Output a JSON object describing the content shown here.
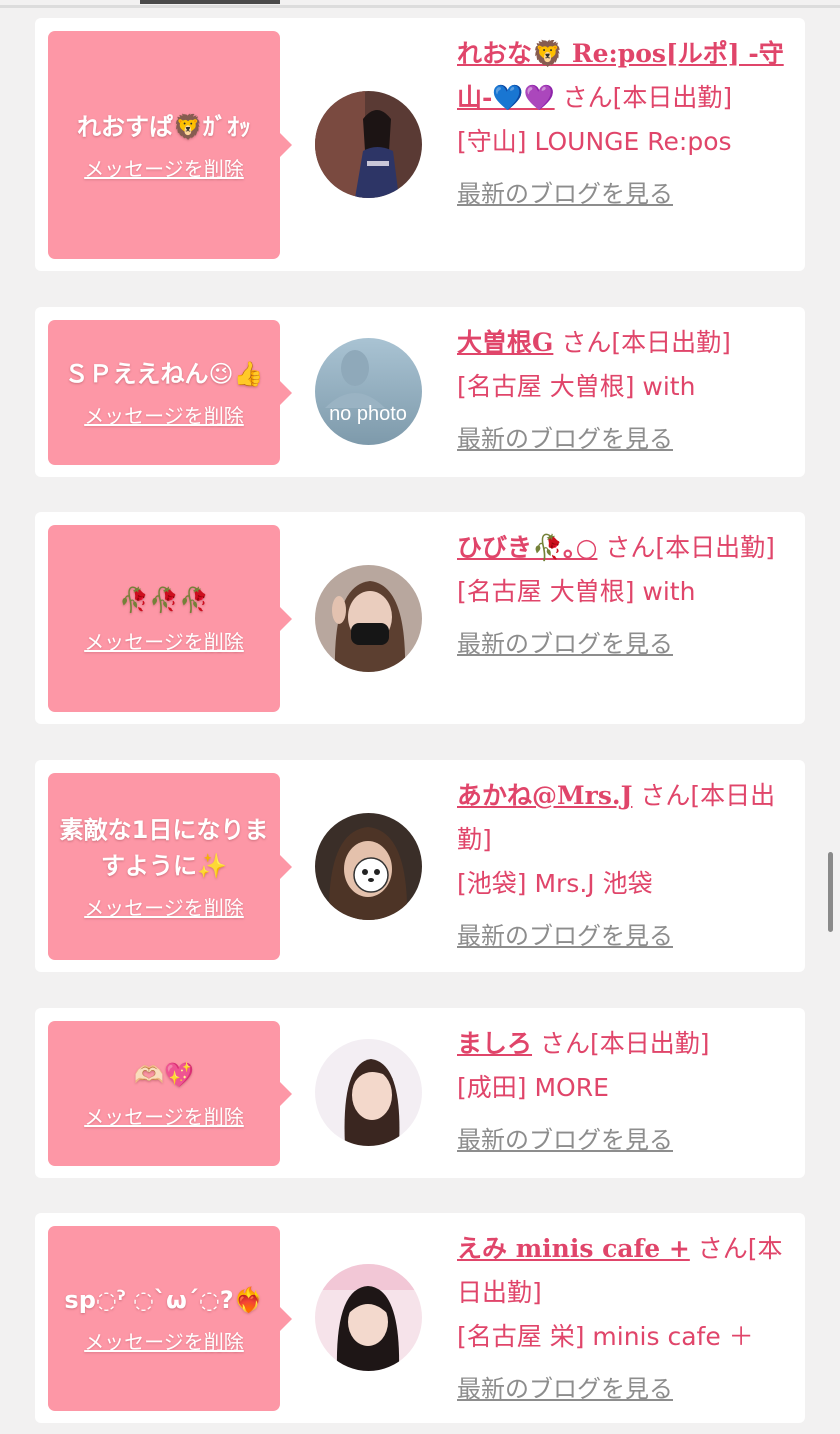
{
  "entries": [
    {
      "message": "れおすぱ🦁ｶﾞｵｯ",
      "delete_label": "メッセージを削除",
      "name": "れおな🦁 Re:pos[ルポ] -守山-💙💜",
      "san": "さん[本日出勤]",
      "shop": "[守山] LOUNGE Re:pos",
      "blog_link": "最新のブログを見る"
    },
    {
      "message": "ＳＰええねん😉👍",
      "delete_label": "メッセージを削除",
      "name": "大曽根G",
      "san": "さん[本日出勤]",
      "shop": "[名古屋 大曽根] with",
      "blog_link": "最新のブログを見る",
      "avatar_text": "no photo"
    },
    {
      "message": "🥀🥀🥀",
      "delete_label": "メッセージを削除",
      "name": "ひびき🥀｡○",
      "san": "さん[本日出勤]",
      "shop": "[名古屋 大曽根] with",
      "blog_link": "最新のブログを見る"
    },
    {
      "message": "素敵な1日になりますように✨",
      "delete_label": "メッセージを削除",
      "name": "あかね@Mrs.J",
      "san": "さん[本日出勤]",
      "shop": "[池袋] Mrs.J 池袋",
      "blog_link": "最新のブログを見る"
    },
    {
      "message": "🫶🏻💖",
      "delete_label": "メッセージを削除",
      "name": "ましろ",
      "san": "さん[本日出勤]",
      "shop": "[成田] MORE",
      "blog_link": "最新のブログを見る"
    },
    {
      "message": "sp◌ˀ ◌`ω´◌?❤️‍🔥",
      "delete_label": "メッセージを削除",
      "name": "えみ minis cafe +",
      "san": "さん[本日出勤]",
      "shop": "[名古屋 栄] minis cafe ＋",
      "blog_link": "最新のブログを見る"
    }
  ],
  "colors": {
    "page_bg": "#f2f1f1",
    "bubble": "#fd97a6",
    "accent": "#e0456a",
    "link_gray": "#8d8d8d"
  }
}
